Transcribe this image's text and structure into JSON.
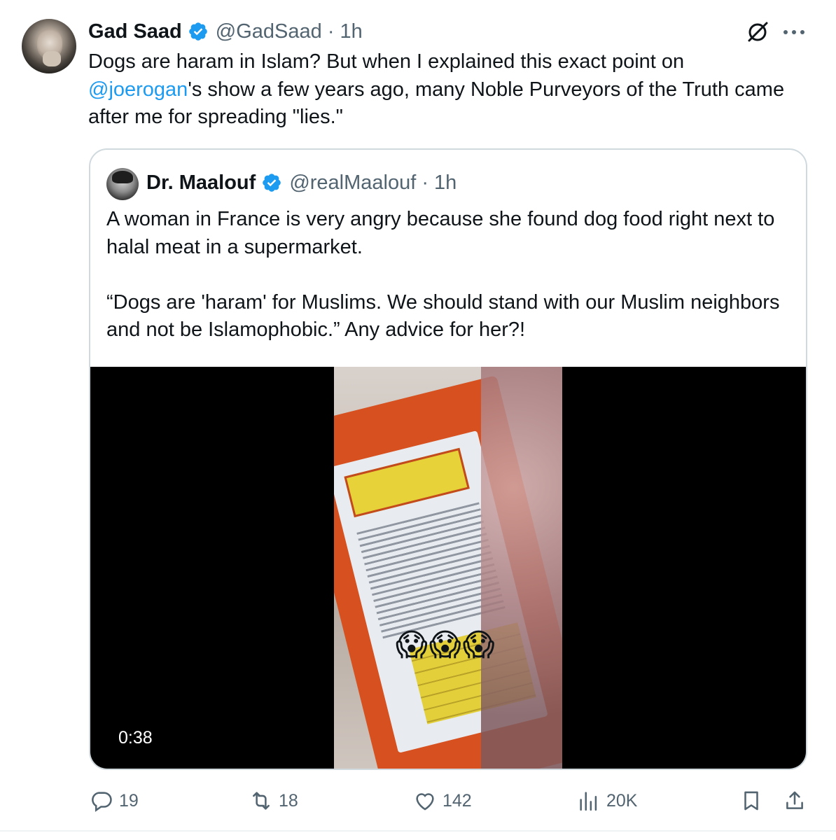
{
  "tweet": {
    "author_name": "Gad Saad",
    "handle_time": "@GadSaad · 1h",
    "text_part1": "Dogs are haram in Islam?  But when I explained this exact point on ",
    "mention": "@joerogan",
    "text_part2": "'s show a few years ago, many Noble Purveyors of the Truth came after me for spreading \"lies.\"",
    "more_label": "···"
  },
  "quote": {
    "author_name": "Dr. Maalouf",
    "handle_time": "@realMaalouf · 1h",
    "paragraph1": "A woman in France is very angry because she found dog food right next to halal meat in a supermarket.",
    "paragraph2": "“Dogs are 'haram' for Muslims. We should stand with our Muslim neighbors and not be Islamophobic.” Any advice for her?!",
    "video_emojis": "😱😱😱",
    "video_duration": "0:38"
  },
  "actions": {
    "replies": "19",
    "reposts": "18",
    "likes": "142",
    "views": "20K"
  },
  "colors": {
    "verified": "#1d9bf0",
    "link": "#1d9bf0",
    "muted": "#536471",
    "border": "#cfd9de"
  }
}
